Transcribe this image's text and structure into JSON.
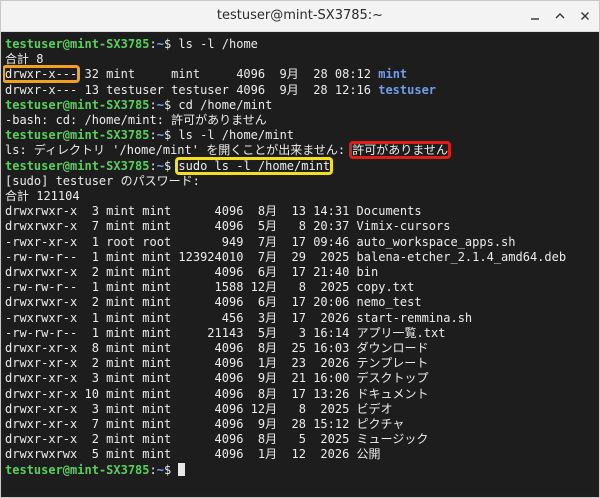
{
  "window": {
    "title": "testuser@mint-SX3785:~"
  },
  "terminal": {
    "lines": [
      [
        {
          "t": "testuser@mint-SX3785",
          "c": "g"
        },
        {
          "t": ":",
          "c": "w"
        },
        {
          "t": "~",
          "c": "b"
        },
        {
          "t": "$ ls -l /home",
          "c": "w"
        }
      ],
      [
        {
          "t": "合計 8",
          "c": "w"
        }
      ],
      [
        {
          "t": "drwxr-x---",
          "c": "w"
        },
        {
          "t": " 32 mint     mint     4096  9月  28 08:12 ",
          "c": "w"
        },
        {
          "t": "mint",
          "c": "dir"
        }
      ],
      [
        {
          "t": "drwxr-x--- 13 testuser testuser 4096  9月  28 12:16 ",
          "c": "w"
        },
        {
          "t": "testuser",
          "c": "dir"
        }
      ],
      [
        {
          "t": "testuser@mint-SX3785",
          "c": "g"
        },
        {
          "t": ":",
          "c": "w"
        },
        {
          "t": "~",
          "c": "b"
        },
        {
          "t": "$ cd /home/mint",
          "c": "w"
        }
      ],
      [
        {
          "t": "-bash: cd: /home/mint: 許可がありません",
          "c": "w"
        }
      ],
      [
        {
          "t": "testuser@mint-SX3785",
          "c": "g"
        },
        {
          "t": ":",
          "c": "w"
        },
        {
          "t": "~",
          "c": "b"
        },
        {
          "t": "$ ls -l /home/mint",
          "c": "w"
        }
      ],
      [
        {
          "t": "ls: ディレクトリ '/home/mint' を開くことが出来ません: ",
          "c": "w"
        },
        {
          "t": "許可がありません",
          "c": "w"
        }
      ],
      [
        {
          "t": "testuser@mint-SX3785",
          "c": "g"
        },
        {
          "t": ":",
          "c": "w"
        },
        {
          "t": "~",
          "c": "b"
        },
        {
          "t": "$ ",
          "c": "w"
        },
        {
          "t": "sudo ls -l /home/mint",
          "c": "w"
        }
      ],
      [
        {
          "t": "[sudo] testuser のパスワード:",
          "c": "w"
        }
      ],
      [
        {
          "t": "合計 121104",
          "c": "w"
        }
      ],
      [
        {
          "t": "drwxrwxr-x  3 mint mint      4096  8月  13 14:31 Documents",
          "c": "w"
        }
      ],
      [
        {
          "t": "drwxrwxr-x  7 mint mint      4096  5月   8 20:37 Vimix-cursors",
          "c": "w"
        }
      ],
      [
        {
          "t": "-rwxr-xr-x  1 root root       949  7月  17 09:46 auto_workspace_apps.sh",
          "c": "w"
        }
      ],
      [
        {
          "t": "-rw-rw-r--  1 mint mint 123924010  7月  29  2025 balena-etcher_2.1.4_amd64.deb",
          "c": "w"
        }
      ],
      [
        {
          "t": "drwxrwxr-x  2 mint mint      4096  6月  17 21:40 bin",
          "c": "w"
        }
      ],
      [
        {
          "t": "-rw-rw-r--  1 mint mint      1588 12月   8  2025 copy.txt",
          "c": "w"
        }
      ],
      [
        {
          "t": "drwxrwxr-x  2 mint mint      4096  6月  17 20:06 nemo_test",
          "c": "w"
        }
      ],
      [
        {
          "t": "-rwxrwxr-x  1 mint mint       456  3月  17  2026 start-remmina.sh",
          "c": "w"
        }
      ],
      [
        {
          "t": "-rw-rw-r--  1 mint mint     21143  5月   3 16:14 アプリ一覧.txt",
          "c": "w"
        }
      ],
      [
        {
          "t": "drwxr-xr-x  8 mint mint      4096  8月  25 16:03 ダウンロード",
          "c": "w"
        }
      ],
      [
        {
          "t": "drwxr-xr-x  2 mint mint      4096  1月  23  2026 テンプレート",
          "c": "w"
        }
      ],
      [
        {
          "t": "drwxr-xr-x  3 mint mint      4096  9月  21 16:00 デスクトップ",
          "c": "w"
        }
      ],
      [
        {
          "t": "drwxr-xr-x 10 mint mint      4096  8月  17 13:26 ドキュメント",
          "c": "w"
        }
      ],
      [
        {
          "t": "drwxr-xr-x  3 mint mint      4096 12月   8  2025 ビデオ",
          "c": "w"
        }
      ],
      [
        {
          "t": "drwxr-xr-x  7 mint mint      4096  9月  28 15:12 ピクチャ",
          "c": "w"
        }
      ],
      [
        {
          "t": "drwxr-xr-x  2 mint mint      4096  8月   5  2025 ミュージック",
          "c": "w"
        }
      ],
      [
        {
          "t": "drwxrwxrwx  5 mint mint      4096  1月  12  2026 公開",
          "c": "w"
        }
      ],
      [
        {
          "t": "testuser@mint-SX3785",
          "c": "g"
        },
        {
          "t": ":",
          "c": "w"
        },
        {
          "t": "~",
          "c": "b"
        },
        {
          "t": "$ ",
          "c": "w"
        }
      ]
    ]
  },
  "colors": {
    "prompt_user": "#57d05a",
    "prompt_path": "#6aa6ff",
    "directory": "#6f9ee8",
    "highlight_orange": "#f2a023",
    "highlight_red": "#e01b1b",
    "highlight_yellow": "#f0e020"
  },
  "icons": [
    "minimize-icon",
    "maximize-icon",
    "close-icon"
  ]
}
